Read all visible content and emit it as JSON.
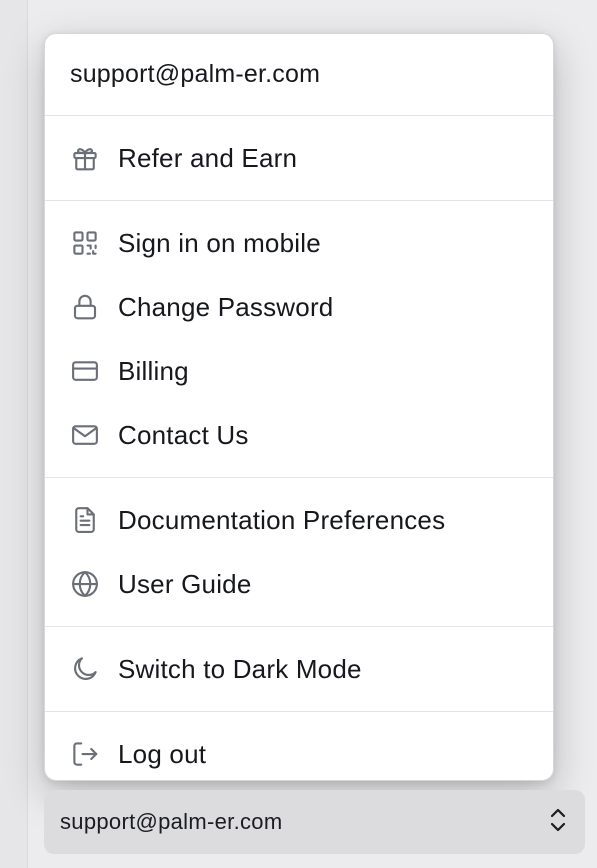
{
  "menu": {
    "email": "support@palm-er.com",
    "sections": [
      {
        "items": [
          {
            "label": "Refer and Earn",
            "icon": "gift-icon"
          }
        ]
      },
      {
        "items": [
          {
            "label": "Sign in on mobile",
            "icon": "qr-code-icon"
          },
          {
            "label": "Change Password",
            "icon": "lock-icon"
          },
          {
            "label": "Billing",
            "icon": "credit-card-icon"
          },
          {
            "label": "Contact Us",
            "icon": "mail-icon"
          }
        ]
      },
      {
        "items": [
          {
            "label": "Documentation Preferences",
            "icon": "document-icon"
          },
          {
            "label": "User Guide",
            "icon": "globe-icon"
          }
        ]
      },
      {
        "items": [
          {
            "label": "Switch to Dark Mode",
            "icon": "moon-icon"
          }
        ]
      },
      {
        "items": [
          {
            "label": "Log out",
            "icon": "log-out-icon"
          }
        ]
      }
    ]
  },
  "account_button": {
    "label": "support@palm-er.com",
    "icon": "chevron-up-down-icon"
  },
  "colors": {
    "menu_bg": "#ffffff",
    "icon": "#6b6f78",
    "text": "#16181d",
    "account_button_bg": "#dcdcdf"
  }
}
